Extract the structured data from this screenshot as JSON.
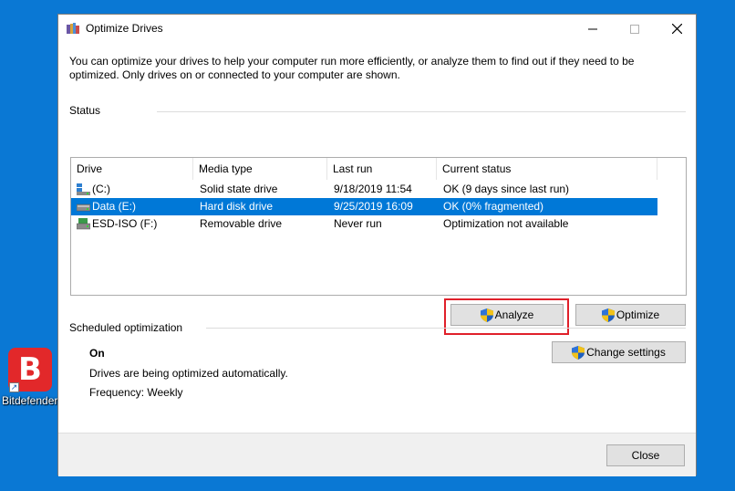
{
  "desktop": {
    "shortcut_label": "Bitdefender",
    "shortcut_icon": "bitdefender-app-icon",
    "tile_letter": "B",
    "background_color": "#0a78d4"
  },
  "window": {
    "title": "Optimize Drives",
    "intro": "You can optimize your drives to help your computer run more efficiently, or analyze them to find out if they need to be optimized. Only drives on or connected to your computer are shown.",
    "status_label": "Status",
    "columns": [
      "Drive",
      "Media type",
      "Last run",
      "Current status"
    ],
    "drives": [
      {
        "drive": "(C:)",
        "media_type": "Solid state drive",
        "last_run": "9/18/2019 11:54",
        "status": "OK (9 days since last run)",
        "icon": "ssd-drive-icon",
        "selected": false
      },
      {
        "drive": "Data (E:)",
        "media_type": "Hard disk drive",
        "last_run": "9/25/2019 16:09",
        "status": "OK (0% fragmented)",
        "icon": "hdd-drive-icon",
        "selected": true
      },
      {
        "drive": "ESD-ISO (F:)",
        "media_type": "Removable drive",
        "last_run": "Never run",
        "status": "Optimization not available",
        "icon": "removable-drive-icon",
        "selected": false
      }
    ],
    "analyze_label": "Analyze",
    "optimize_label": "Optimize",
    "scheduled_label": "Scheduled optimization",
    "schedule_state": "On",
    "schedule_desc": "Drives are being optimized automatically.",
    "frequency": "Frequency: Weekly",
    "change_settings_label": "Change settings",
    "close_label": "Close",
    "accent_color": "#0078d7",
    "highlight_color": "#e0202a"
  }
}
